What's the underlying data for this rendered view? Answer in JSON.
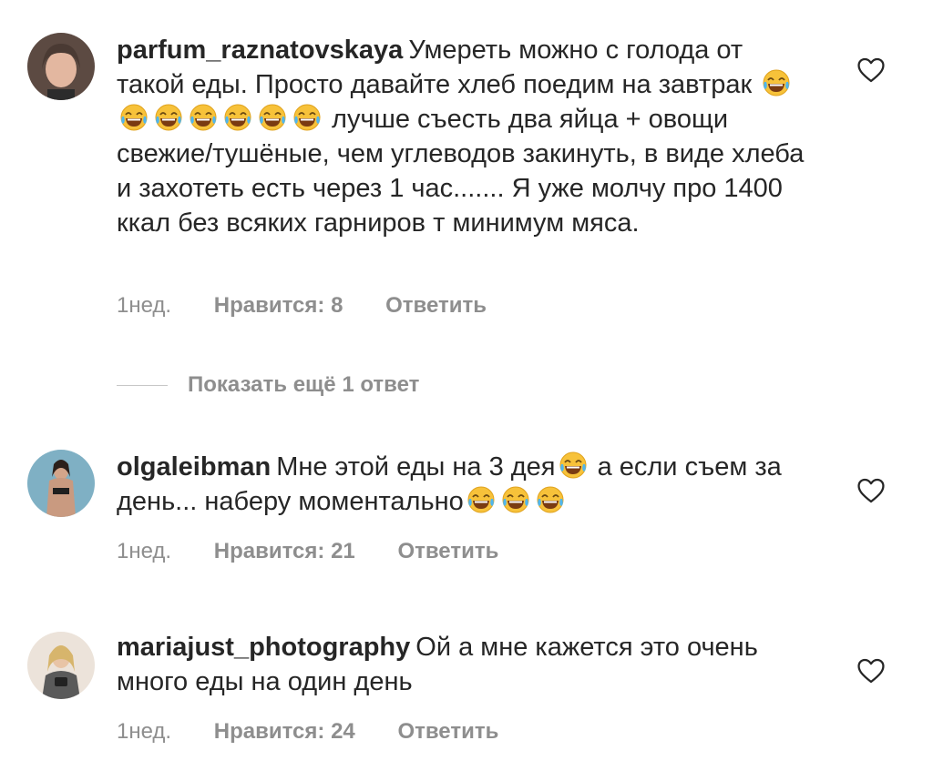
{
  "comments": [
    {
      "username": "parfum_raznatovskaya",
      "text_parts": [
        "Умереть можно с голода от такой еды. Просто давайте хлеб поедим на завтрак ",
        " лучше съесть два яйца + овощи свежие/тушёные, чем углеводов закинуть, в виде хлеба и захотеть есть через 1 час....... Я уже молчу про 1400 ккал без всяких гарниров т минимум мяса."
      ],
      "emoji_count": 7,
      "time": "1нед.",
      "likes": "Нравится: 8",
      "reply": "Ответить",
      "avatar_color": "#8a6a5a"
    },
    {
      "username": "olgaleibman",
      "text_parts": [
        "Мне этой еды на 3 дея",
        " а если съем за день... наберу моментально",
        ""
      ],
      "time": "1нед.",
      "likes": "Нравится: 21",
      "reply": "Ответить",
      "avatar_color": "#6f9fb3"
    },
    {
      "username": "mariajust_photography",
      "text_parts": [
        "Ой а мне кажется это очень много еды на один день"
      ],
      "time": "1нед.",
      "likes": "Нравится: 24",
      "reply": "Ответить",
      "avatar_color": "#d9c7b5"
    }
  ],
  "show_more_replies": "Показать ещё 1 ответ",
  "icons": {
    "emoji": "face-with-tears-of-joy-icon",
    "like": "heart-outline-icon"
  },
  "colors": {
    "text": "#262626",
    "secondary": "#8e8e8e",
    "emoji_yellow": "#f7c23a"
  }
}
